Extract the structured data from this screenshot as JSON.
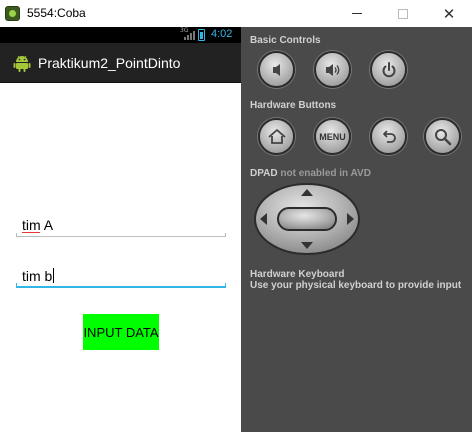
{
  "window": {
    "title": "5554:Coba",
    "minimize_label": "",
    "maximize_label": "",
    "close_label": "✕"
  },
  "device": {
    "status_bar": {
      "network": "3G",
      "time": "4:02"
    },
    "action_bar": {
      "app_title": "Praktikum2_PointDinto"
    },
    "fields": [
      {
        "value": "tim A"
      },
      {
        "value": "tim b"
      }
    ],
    "input_button_label": "INPUT DATA",
    "input_button_color": "#00ff00"
  },
  "panel": {
    "basic_controls_title": "Basic Controls",
    "basic_controls": [
      {
        "icon": "volume-down-icon"
      },
      {
        "icon": "volume-up-icon"
      },
      {
        "icon": "power-icon"
      }
    ],
    "hardware_buttons_title": "Hardware Buttons",
    "hardware_buttons": [
      {
        "icon": "home-icon"
      },
      {
        "icon": "menu-button",
        "label": "MENU"
      },
      {
        "icon": "back-icon"
      },
      {
        "icon": "search-icon"
      }
    ],
    "dpad_title_prefix": "DPAD",
    "dpad_title_suffix": "not enabled in AVD",
    "keyboard_title": "Hardware Keyboard",
    "keyboard_desc": "Use your physical keyboard to provide input"
  },
  "colors": {
    "panel_bg": "#4a4a4a",
    "action_bar_bg": "#222222",
    "status_accent": "#33b5e5",
    "focus_underline": "#33b5e5"
  }
}
